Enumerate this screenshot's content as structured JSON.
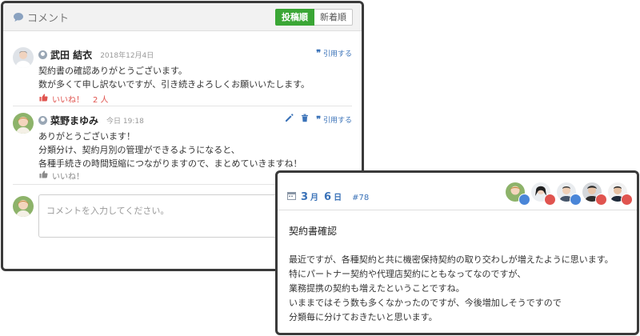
{
  "comments_panel": {
    "title": "コメント",
    "sort_options": [
      "投稿順",
      "新着順"
    ],
    "comments": [
      {
        "name": "武田 結衣",
        "date": "2018年12月4日",
        "lines": [
          "契約書の確認ありがとうございます。",
          "数が多くて申し訳ないですが、引き続きよろしくお願いいたします。"
        ],
        "like_label": "いいね！",
        "like_count": "2 人",
        "quote_label": "引用する"
      },
      {
        "name": "菜野まゆみ",
        "date": "今日 19:18",
        "lines": [
          "ありがとうございます！",
          "分類分け、契約月別の管理ができるようになると、",
          "各種手続きの時間短縮につながりますので、まとめていきますね！"
        ],
        "like_label": "いいね！",
        "quote_label": "引用する"
      }
    ],
    "input_placeholder": "コメントを入力してください。"
  },
  "memo_panel": {
    "month": "3",
    "month_unit": "月",
    "day": "6",
    "day_unit": "日",
    "number": "#78",
    "title": "契約書確認",
    "lines": [
      "最近ですが、各種契約と共に機密保持契約の取り交わしが増えたように思います。",
      "特にパートナー契約や代理店契約にともなってなのですが、",
      "業務提携の契約も増えたということですね。",
      "いままではそう数も多くなかったのですが、今後増加しそうですので",
      "分類毎に分けておきたいと思います。"
    ],
    "reactions": [
      {
        "badge": "blue"
      },
      {
        "badge": "red"
      },
      {
        "badge": "blue"
      },
      {
        "badge": "red"
      },
      {
        "badge": "red"
      }
    ]
  },
  "colors": {
    "accent_blue": "#3a72b8",
    "like_red": "#e0544f",
    "sort_active": "#3aa635"
  }
}
